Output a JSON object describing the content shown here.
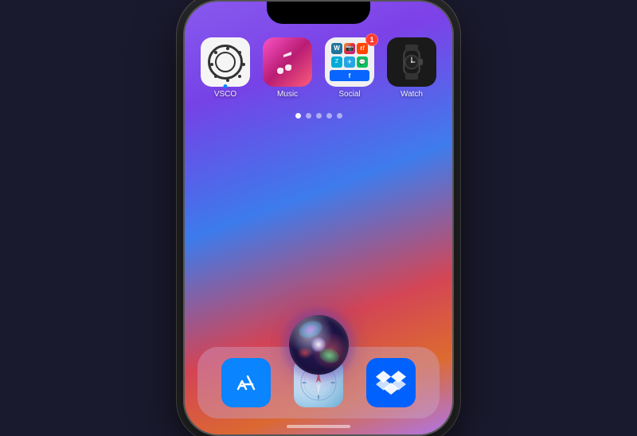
{
  "phone": {
    "screen": {
      "apps": {
        "row1": [
          {
            "id": "vsco",
            "label": "VSCO",
            "type": "vsco",
            "has_indicator": true
          },
          {
            "id": "music",
            "label": "Music",
            "type": "music"
          },
          {
            "id": "social",
            "label": "Social",
            "type": "social",
            "badge": "1"
          },
          {
            "id": "watch",
            "label": "Watch",
            "type": "watch"
          }
        ]
      },
      "page_dots": {
        "count": 5,
        "active": 0
      },
      "dock": {
        "apps": [
          {
            "id": "appstore",
            "label": "App Store",
            "type": "appstore"
          },
          {
            "id": "safari",
            "label": "Safari",
            "type": "safari"
          },
          {
            "id": "dropbox",
            "label": "Dropbox",
            "type": "dropbox"
          }
        ]
      },
      "siri": {
        "visible": true
      }
    }
  }
}
